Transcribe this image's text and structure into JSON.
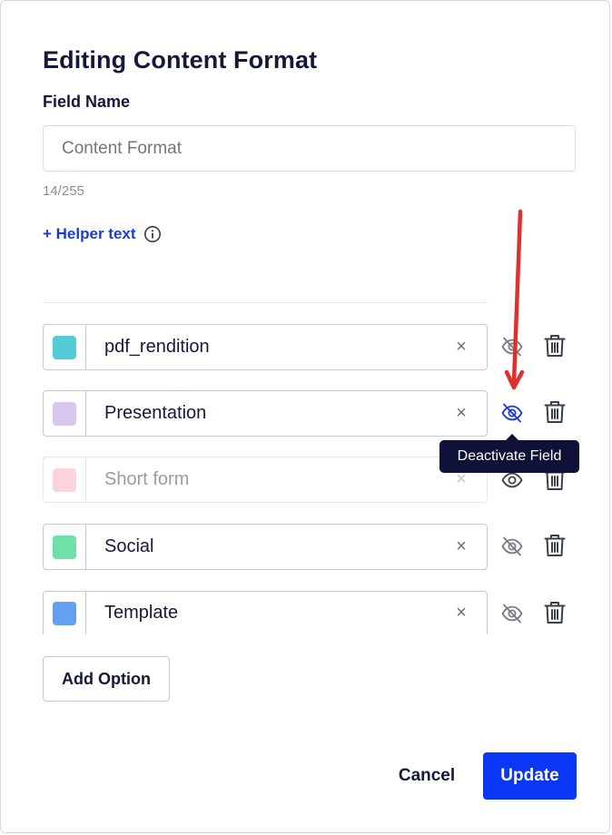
{
  "dialog": {
    "title": "Editing Content Format",
    "field_label": "Field Name",
    "field_value": "",
    "field_placeholder": "Content Format",
    "char_counter": "14/255",
    "helper_link": "+ Helper text"
  },
  "options": [
    {
      "label": "pdf_rendition",
      "color": "#52cdd8",
      "active": true,
      "visibility_icon": "eye-off-icon"
    },
    {
      "label": "Presentation",
      "color": "#d8c8f0",
      "active": true,
      "visibility_icon": "eye-off-icon"
    },
    {
      "label": "Short form",
      "color": "#fbd3da",
      "active": false,
      "visibility_icon": "eye-icon"
    },
    {
      "label": "Social",
      "color": "#6ee0a8",
      "active": true,
      "visibility_icon": "eye-off-icon"
    },
    {
      "label": "Template",
      "color": "#64a0f2",
      "active": true,
      "visibility_icon": "eye-off-icon"
    }
  ],
  "clear_glyph": "×",
  "tooltip": "Deactivate Field",
  "buttons": {
    "add_option": "Add Option",
    "cancel": "Cancel",
    "update": "Update"
  },
  "colors": {
    "primary": "#0a36f5",
    "link": "#1c3bd6",
    "hover_icon": "#1c3bd6",
    "annotation": "#e0302e"
  }
}
